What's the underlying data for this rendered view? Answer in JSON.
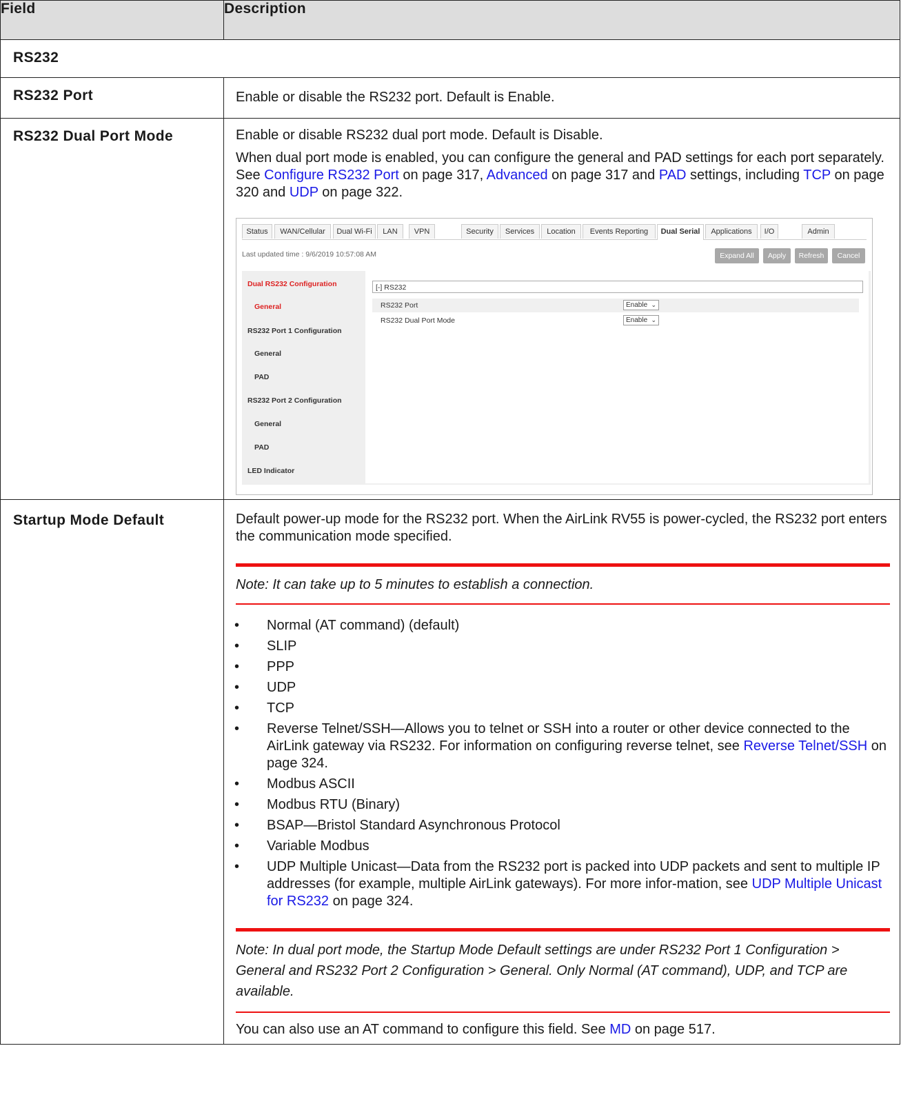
{
  "table": {
    "headers": [
      "Field",
      "Description"
    ],
    "section_label": "RS232",
    "rs232_port": {
      "field": "RS232 Port",
      "desc": "Enable or disable the RS232 port. Default is Enable."
    },
    "dual_port_mode": {
      "field": "RS232 Dual Port Mode",
      "line1": "Enable or disable RS232 dual port mode. Default is Disable.",
      "p2_a": "When dual port mode is enabled, you can configure the general and PAD settings for each port separately. See ",
      "p2_link1": "Configure RS232 Port",
      "p2_b": " on page 317, ",
      "p2_link2": "Advanced",
      "p2_c": " on page 317 and ",
      "p2_link3": "PAD",
      "p2_d": " settings, including ",
      "p2_link4": "TCP",
      "p2_e": " on page 320 and ",
      "p2_link5": "UDP",
      "p2_f": " on page 322."
    },
    "startup_mode": {
      "field": "Startup Mode Default",
      "intro": "Default power-up mode for the RS232 port. When the AirLink RV55 is power-cycled, the RS232 port enters the communication mode specified.",
      "note1": "Note:  It can take up to 5 minutes to establish a connection.",
      "bullet_char": "•",
      "options": {
        "o1": "Normal (AT command) (default)",
        "o2": "SLIP",
        "o3": "PPP",
        "o4": "UDP",
        "o5": "TCP",
        "o6_a": "Reverse Telnet/SSH—Allows you to telnet or SSH into a router or other device connected to the AirLink gateway via RS232. For information on configuring reverse telnet, see ",
        "o6_link": "Reverse Telnet/SSH",
        "o6_b": " on page 324.",
        "o7": "Modbus ASCII",
        "o8": "Modbus RTU (Binary)",
        "o9": "BSAP—Bristol Standard Asynchronous Protocol",
        "o10": "Variable Modbus",
        "o11_a": "UDP Multiple Unicast—Data from the RS232 port is packed into UDP packets and sent to multiple IP addresses (for example, multiple AirLink gateways). For more infor-mation, see ",
        "o11_link": "UDP Multiple Unicast for RS232",
        "o11_b": " on page 324."
      },
      "note2": "Note:  In dual port mode, the Startup Mode Default settings are under RS232 Port 1 Configuration > General and RS232 Port 2 Configuration > General. Only Normal (AT command), UDP, and TCP are available.",
      "last_a": "You can also use an AT command to configure this field. See ",
      "last_link": "MD",
      "last_b": " on page 517."
    }
  },
  "screenshot": {
    "tabs": {
      "status": "Status",
      "wan": "WAN/Cellular",
      "wifi": "Dual Wi-Fi",
      "lan": "LAN",
      "vpn": "VPN",
      "security": "Security",
      "services": "Services",
      "location": "Location",
      "events": "Events Reporting",
      "dual_serial": "Dual Serial",
      "applications": "Applications",
      "io": "I/O",
      "admin": "Admin"
    },
    "last_updated": "Last updated time : 9/6/2019 10:57:08 AM",
    "buttons": {
      "expand": "Expand All",
      "apply": "Apply",
      "refresh": "Refresh",
      "cancel": "Cancel"
    },
    "nav": {
      "dual_config": "Dual RS232 Configuration",
      "general1": "General",
      "port1_config": "RS232 Port 1 Configuration",
      "general2": "General",
      "pad1": "PAD",
      "port2_config": "RS232 Port 2 Configuration",
      "general3": "General",
      "pad2": "PAD",
      "led": "LED Indicator"
    },
    "section_header": "[-] RS232",
    "rows": {
      "port_label": "RS232 Port",
      "port_value": "Enable",
      "dual_label": "RS232 Dual Port Mode",
      "dual_value": "Enable"
    },
    "chevron": "⌄",
    "accent_color": "#dd2222"
  }
}
